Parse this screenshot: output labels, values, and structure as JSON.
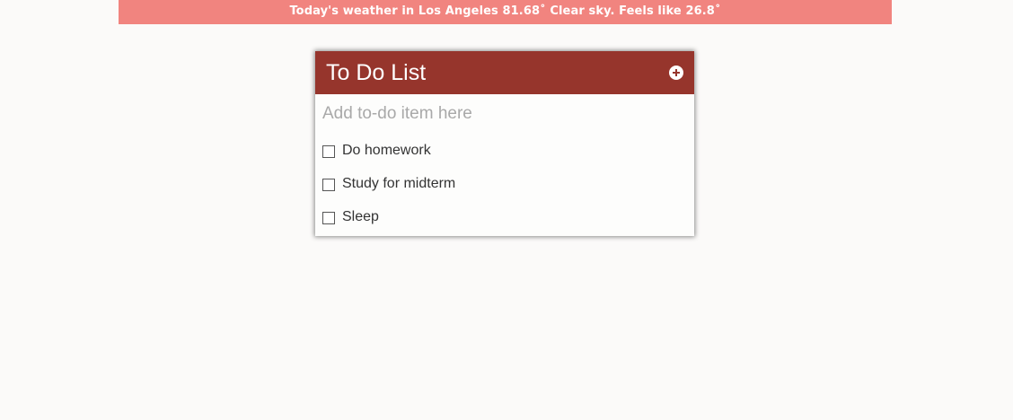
{
  "weather": {
    "text": "Today's weather in Los Angeles 81.68˚ Clear sky. Feels like 26.8˚"
  },
  "todo": {
    "title": "To Do List",
    "add_icon": "plus-circle-icon",
    "input_placeholder": "Add to-do item here",
    "items": [
      {
        "label": "Do homework",
        "checked": false
      },
      {
        "label": "Study for midterm",
        "checked": false
      },
      {
        "label": "Sleep",
        "checked": false
      }
    ]
  },
  "colors": {
    "banner": "#f1847f",
    "header": "#96352c",
    "background": "#fbfaf9"
  }
}
